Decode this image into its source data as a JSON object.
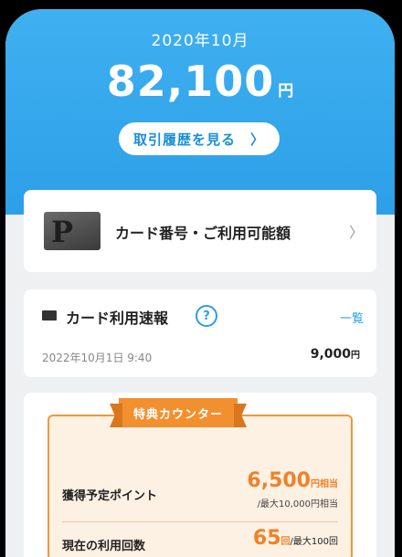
{
  "header": {
    "month": "2020年10月",
    "amount": "82,100",
    "currency": "円",
    "history_button": "取引履歴を見る",
    "history_chevron": "〉"
  },
  "card_info": {
    "card_logo_letter": "P",
    "label": "カード番号・ご利用可能額",
    "chevron": "〉"
  },
  "usage_report": {
    "title": "カード利用速報",
    "help_icon": "?",
    "list_link": "一覧",
    "transaction": {
      "date": "2022年10月1日 9:40",
      "amount": "9,000",
      "currency": "円"
    }
  },
  "benefit_counter": {
    "ribbon_title": "特典カウンター",
    "points_label": "獲得予定ポイント",
    "points_value": "6,500",
    "points_unit": "円相当",
    "points_max": "/最大10,000円相当",
    "uses_label": "現在の利用回数",
    "uses_value": "65",
    "uses_unit": "回",
    "uses_max": "/最大100回"
  },
  "colors": {
    "header_blue": "#2c9fe8",
    "accent_blue": "#2b9de6",
    "orange": "#f0812a",
    "orange_bg": "#fdf1e3"
  }
}
